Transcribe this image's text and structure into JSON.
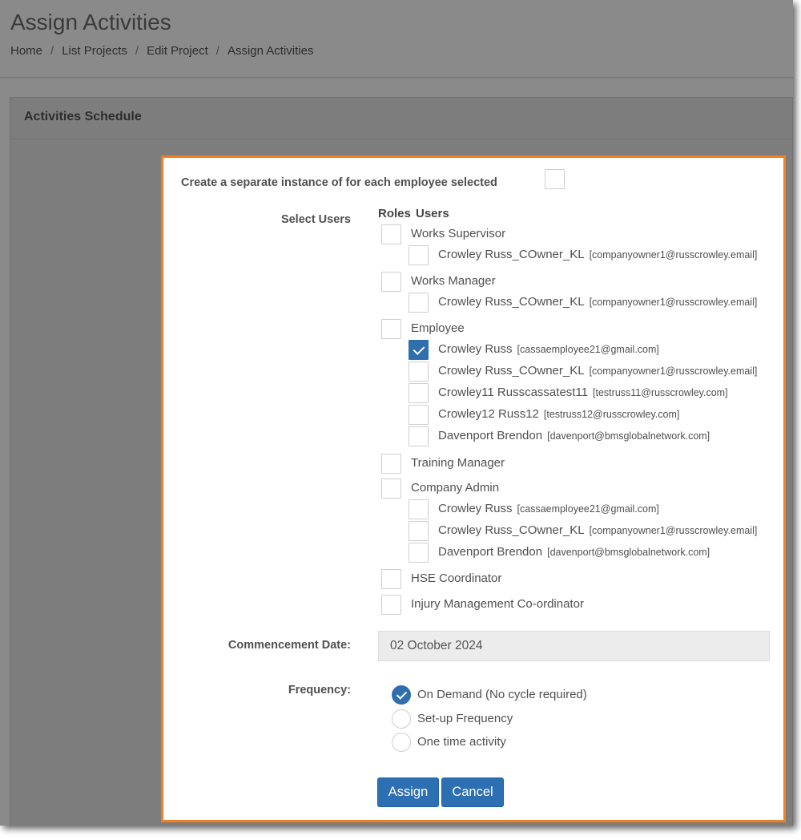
{
  "page": {
    "title": "Assign Activities",
    "breadcrumb": [
      "Home",
      "List Projects",
      "Edit Project",
      "Assign Activities"
    ]
  },
  "panel": {
    "heading": "Activities Schedule"
  },
  "modal": {
    "separate_instance_label": "Create a separate instance of for each employee selected",
    "separate_instance_checked": false,
    "select_users_label": "Select Users",
    "roles_header": "Roles",
    "users_header": "Users",
    "roles": [
      {
        "name": "Works Supervisor",
        "checked": false,
        "users": [
          {
            "name": "Crowley Russ_COwner_KL",
            "email": "[companyowner1@russcrowley.email]",
            "checked": false
          }
        ]
      },
      {
        "name": "Works Manager",
        "checked": false,
        "users": [
          {
            "name": "Crowley Russ_COwner_KL",
            "email": "[companyowner1@russcrowley.email]",
            "checked": false
          }
        ]
      },
      {
        "name": "Employee",
        "checked": false,
        "users": [
          {
            "name": "Crowley Russ",
            "email": "[cassaemployee21@gmail.com]",
            "checked": true
          },
          {
            "name": "Crowley Russ_COwner_KL",
            "email": "[companyowner1@russcrowley.email]",
            "checked": false
          },
          {
            "name": "Crowley11 Russcassatest11",
            "email": "[testruss11@russcrowley.com]",
            "checked": false
          },
          {
            "name": "Crowley12 Russ12",
            "email": "[testruss12@russcrowley.com]",
            "checked": false
          },
          {
            "name": "Davenport Brendon",
            "email": "[davenport@bmsglobalnetwork.com]",
            "checked": false
          }
        ]
      },
      {
        "name": "Training Manager",
        "checked": false,
        "users": []
      },
      {
        "name": "Company Admin",
        "checked": false,
        "users": [
          {
            "name": "Crowley Russ",
            "email": "[cassaemployee21@gmail.com]",
            "checked": false
          },
          {
            "name": "Crowley Russ_COwner_KL",
            "email": "[companyowner1@russcrowley.email]",
            "checked": false
          },
          {
            "name": "Davenport Brendon",
            "email": "[davenport@bmsglobalnetwork.com]",
            "checked": false
          }
        ]
      },
      {
        "name": "HSE Coordinator",
        "checked": false,
        "users": []
      },
      {
        "name": "Injury Management Co-ordinator",
        "checked": false,
        "users": []
      }
    ],
    "commencement_label": "Commencement Date:",
    "commencement_value": "02 October 2024",
    "frequency_label": "Frequency:",
    "frequency_options": [
      {
        "label": "On Demand (No cycle required)",
        "selected": true
      },
      {
        "label": "Set-up Frequency",
        "selected": false
      },
      {
        "label": "One time activity",
        "selected": false
      }
    ],
    "assign_label": "Assign",
    "cancel_label": "Cancel"
  },
  "colors": {
    "accent_border": "#f0811e",
    "primary_button": "#2d6fb3"
  }
}
